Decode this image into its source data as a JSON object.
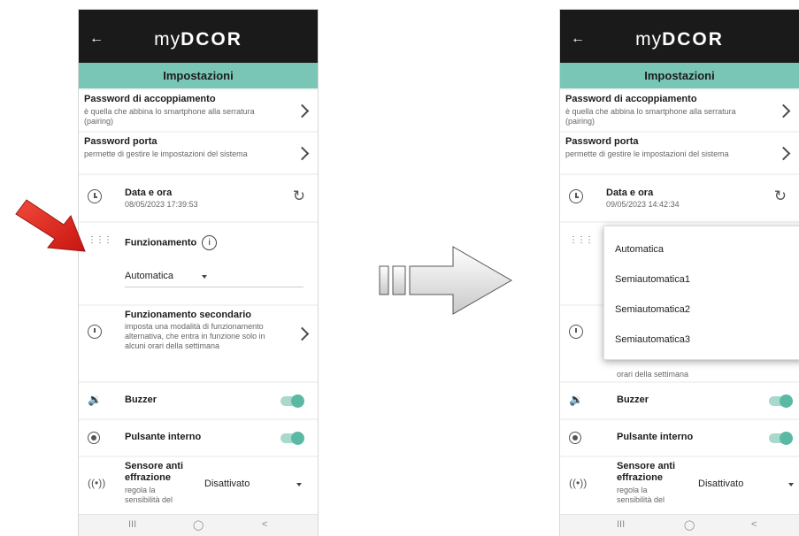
{
  "left_screen": {
    "logo": {
      "prefix": "my",
      "brand": "DCOR"
    },
    "header_title": "Impostazioni",
    "pairing": {
      "title": "Password di accoppiamento",
      "desc": "è quella che abbina lo smartphone alla serratura (pairing)"
    },
    "door_password": {
      "title": "Password porta",
      "desc": "permette di gestire le impostazioni del sistema"
    },
    "datetime": {
      "title": "Data e ora",
      "value": "08/05/2023 17:39:53"
    },
    "operation": {
      "title": "Funzionamento",
      "selected": "Automatica"
    },
    "secondary": {
      "title": "Funzionamento secondario",
      "desc": "imposta una modalità di funzionamento alternativa, che entra in funzione solo in alcuni orari della settimana"
    },
    "buzzer": {
      "label": "Buzzer",
      "on": true
    },
    "internal_button": {
      "label": "Pulsante interno",
      "on": true
    },
    "tamper": {
      "title": "Sensore anti effrazione",
      "desc": "regola la sensibilità del",
      "value": "Disattivato"
    }
  },
  "right_screen": {
    "logo": {
      "prefix": "my",
      "brand": "DCOR"
    },
    "header_title": "Impostazioni",
    "pairing": {
      "title": "Password di accoppiamento",
      "desc": "è quella che abbina lo smartphone alla serratura (pairing)"
    },
    "door_password": {
      "title": "Password porta",
      "desc": "permette di gestire le impostazioni del sistema"
    },
    "datetime": {
      "title": "Data e ora",
      "value": "09/05/2023 14:42:34"
    },
    "dropdown_options": [
      "Automatica",
      "Semiautomatica1",
      "Semiautomatica2",
      "Semiautomatica3"
    ],
    "secondary_visible_desc": "orari della settimana",
    "buzzer": {
      "label": "Buzzer",
      "on": true
    },
    "internal_button": {
      "label": "Pulsante interno",
      "on": true
    },
    "tamper": {
      "title": "Sensore anti effrazione",
      "desc": "regola la sensibilità del",
      "value": "Disattivato"
    }
  },
  "colors": {
    "appbar": "#1a1a1a",
    "header": "#79c6b7",
    "toggle": "#5bb9a3",
    "red_arrow": "#e8261c",
    "gray_arrow": "#d0d0d0"
  },
  "icons": [
    "back-arrow-icon",
    "chevron-right-icon",
    "clock-icon",
    "refresh-icon",
    "dots-icon",
    "info-icon",
    "timer-icon",
    "speaker-icon",
    "radio-icon",
    "sensor-icon",
    "red-arrow-icon",
    "gray-arrow-icon"
  ]
}
